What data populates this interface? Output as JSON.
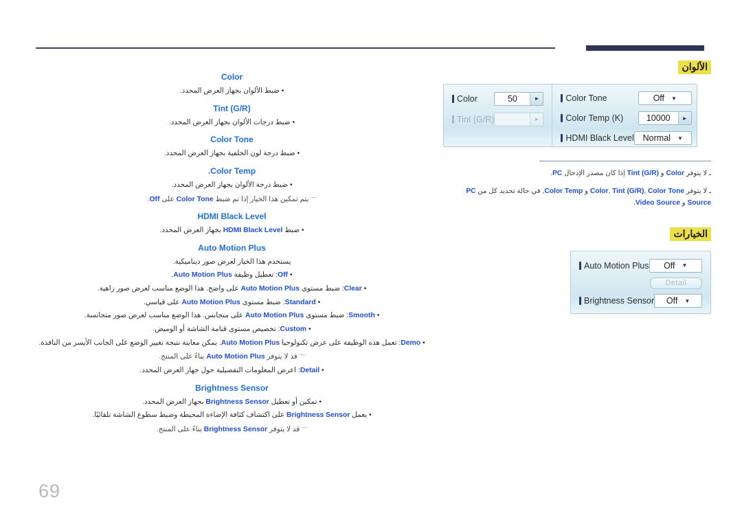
{
  "page": {
    "number": "69"
  },
  "sections": {
    "colors": {
      "heading": "الألوان"
    },
    "options": {
      "heading": "الخيارات"
    }
  },
  "osd_colors": {
    "left_rows": [
      {
        "label": "Color",
        "value": "50",
        "widget": "spinner",
        "disabled": false
      },
      {
        "label": "Tint (G/R)",
        "value": "",
        "widget": "spinner",
        "disabled": true
      }
    ],
    "right_rows": [
      {
        "label": "Color Tone",
        "value": "Off",
        "widget": "dropdown",
        "disabled": false
      },
      {
        "label": "Color Temp (K)",
        "value": "10000",
        "widget": "spinner",
        "disabled": false
      },
      {
        "label": "HDMI Black Level",
        "value": "Normal",
        "widget": "dropdown",
        "disabled": false
      }
    ]
  },
  "osd_options": {
    "rows": [
      {
        "label": "Auto Motion Plus",
        "value": "Off",
        "widget": "dropdown",
        "disabled": false
      },
      {
        "label": "Brightness Sensor",
        "value": "Off",
        "widget": "dropdown",
        "disabled": false
      }
    ],
    "detail_button": "Detail"
  },
  "notes": [
    "ـ لا يتوفر <b>Color</b> و <b>Tint (G/R)</b> إذا كان مصدر الإدخال <b>PC</b>.",
    "ـ لا يتوفر <b>Color</b>, <b>Tint (G/R)</b>, <b>Color Tone</b> و <b>Color Temp</b>, في حالة تحديد كل من <b>PC Source</b> و <b>Video Source</b>."
  ],
  "body": [
    {
      "type": "heading",
      "text": "Color"
    },
    {
      "type": "bullet",
      "text": "• ضبط الألوان بجهاز العرض المحدد."
    },
    {
      "type": "heading",
      "text": "Tint (G/R)"
    },
    {
      "type": "bullet",
      "text": "• ضبط درجات الألوان بجهاز العرض المحدد."
    },
    {
      "type": "heading",
      "text": "Color Tone"
    },
    {
      "type": "bullet",
      "text": "• ضبط درجة لون الخلفية بجهاز العرض المحدد."
    },
    {
      "type": "heading",
      "text": "Color Temp."
    },
    {
      "type": "bullet",
      "text": "• ضبط درجة الألوان بجهاز العرض المحدد."
    },
    {
      "type": "tip",
      "text": "يتم تمكين هذا الخيار إذا تم ضبط <b>Color Tone</b> على <b>Off</b>."
    },
    {
      "type": "heading",
      "text": "HDMI Black Level"
    },
    {
      "type": "bullet",
      "text": "• ضبط <b>HDMI Black Level</b> بجهاز العرض المحدد."
    },
    {
      "type": "heading",
      "text": "Auto Motion Plus"
    },
    {
      "type": "bullet",
      "text": "يستخدم هذا الخيار لعرض صور ديناميكية."
    },
    {
      "type": "bullet",
      "text": "• <b>Off</b>: تعطيل وظيفة <b>Auto Motion Plus</b>."
    },
    {
      "type": "bullet",
      "text": "• <b>Clear</b>: ضبط مستوى <b>Auto Motion Plus</b> على واضح. هذا الوضع مناسب لعرض صور زاهية."
    },
    {
      "type": "bullet",
      "text": "• <b>Standard</b>: ضبط مستوى <b>Auto Motion Plus</b> على قياسي."
    },
    {
      "type": "bullet",
      "text": "• <b>Smooth</b>: ضبط مستوى <b>Auto Motion Plus</b> على متجانس. هذا الوضع مناسب لعرض صور متجانسة."
    },
    {
      "type": "bullet",
      "text": "• <b>Custom</b>: تخصيص مستوى قتامة الشاشة أو الوميض."
    },
    {
      "type": "bullet",
      "text": "• <b>Demo</b>: تعمل هذه الوظيفة على عرض تكنولوجيا <b>Auto Motion Plus</b>. يمكن معاينة نتيجة تغيير الوضع على الجانب الأيسر من النافذة."
    },
    {
      "type": "tip",
      "text": "قد لا يتوفر <b>Auto Motion Plus</b> بناءً على المنتج."
    },
    {
      "type": "bullet",
      "text": "• <b>Detail</b>: اعرض المعلومات التفصيلية حول جهاز العرض المحدد."
    },
    {
      "type": "heading",
      "text": "Brightness Sensor"
    },
    {
      "type": "bullet",
      "text": "• تمكين أو تعطيل <b>Brightness Sensor</b> بجهاز العرض المحدد."
    },
    {
      "type": "bullet",
      "text": "• يعمل <b>Brightness Sensor</b> على اكتشاف كثافة الإضاءة المحيطة وضبط سطوع الشاشة تلقائيًا."
    },
    {
      "type": "tip",
      "text": "قد لا يتوفر <b>Brightness Sensor</b> بناءً على المنتج."
    }
  ]
}
